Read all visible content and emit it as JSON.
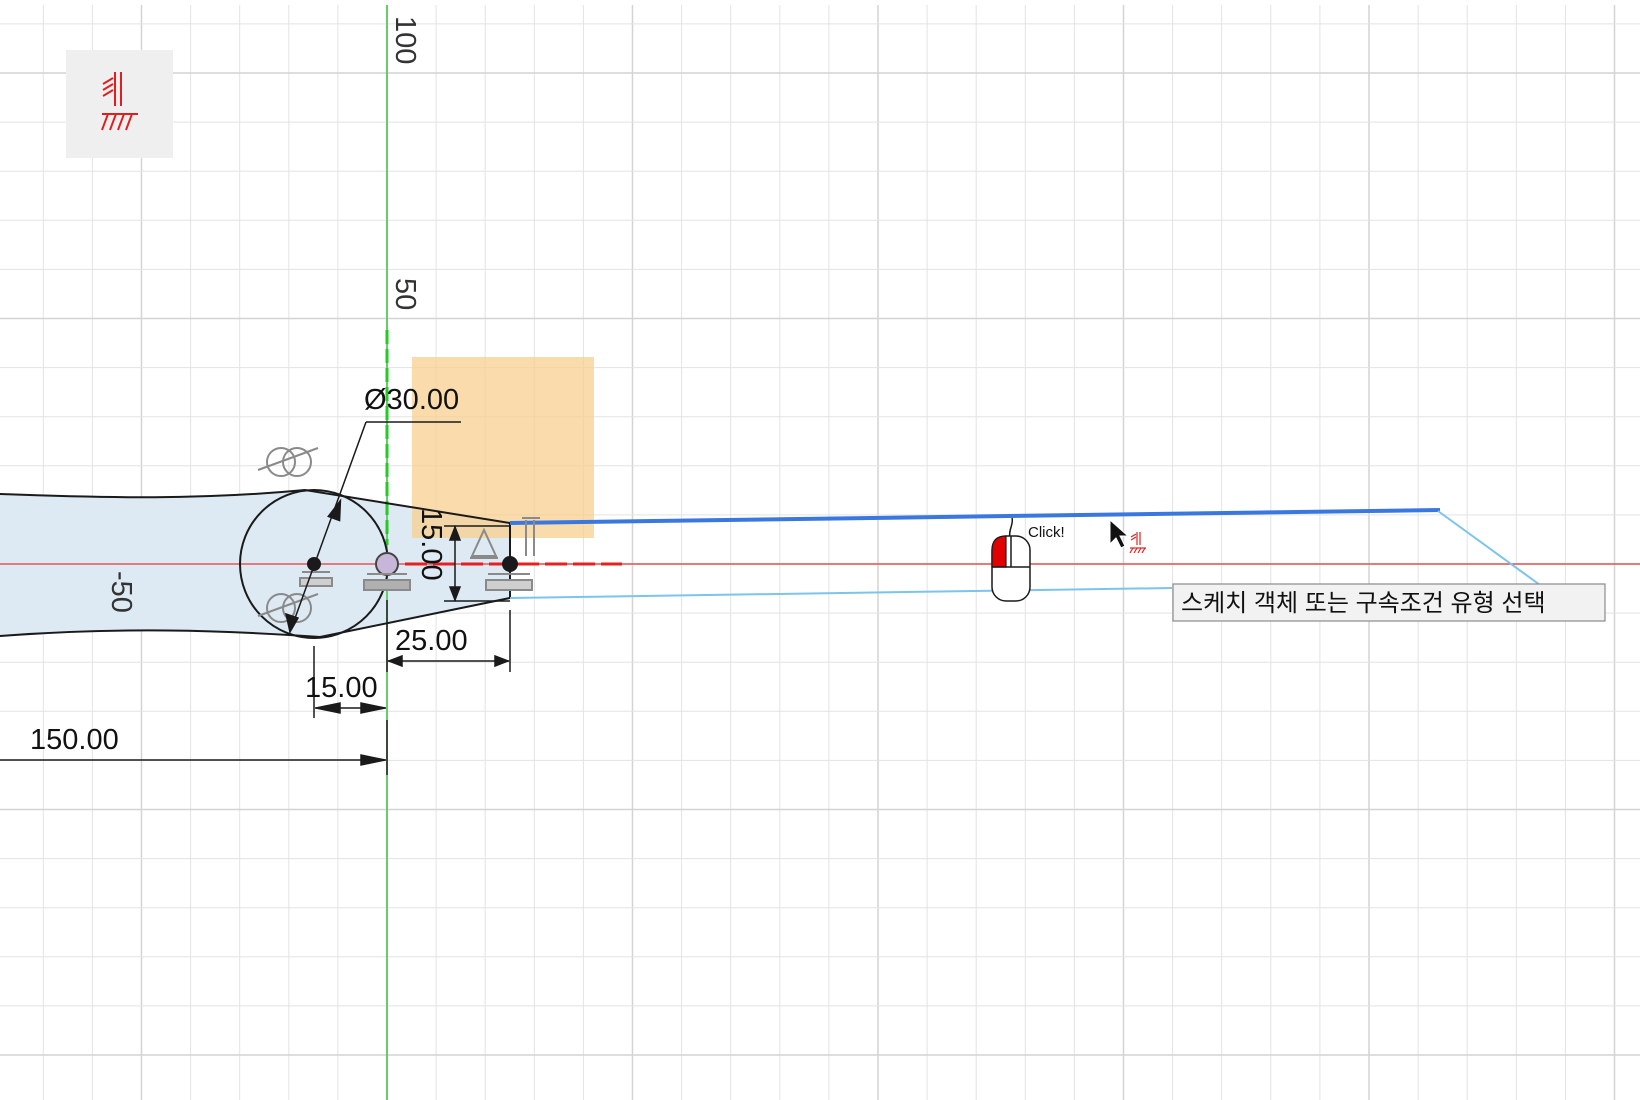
{
  "viewport": {
    "background": "#ffffff",
    "grid_color": "#e3e3e3",
    "major_grid_color": "#d4d4d4"
  },
  "constraint_icon": {
    "icon": "fix-constraint-icon",
    "accent": "#e02020"
  },
  "axis_labels": {
    "y_100": "100",
    "y_50": "50",
    "x_minus_50": "-50"
  },
  "dimensions": {
    "diameter": "Ø30.00",
    "vertical_15": "15.00",
    "horizontal_25": "25.00",
    "horizontal_15": "15.00",
    "horizontal_150": "150.00"
  },
  "mouse_hint": {
    "label": "Click!",
    "button_color": "#e00000"
  },
  "tooltip": {
    "text": "스케치 객체 또는 구속조건 유형 선택"
  },
  "colors": {
    "x_axis": "#e23a3a",
    "y_axis": "#3ec43e",
    "selection_blue": "#3a78e0",
    "leader_blue": "#7cc4ec",
    "profile_fill": "#dde9f3",
    "highlight_orange": "#f8cf8f"
  }
}
